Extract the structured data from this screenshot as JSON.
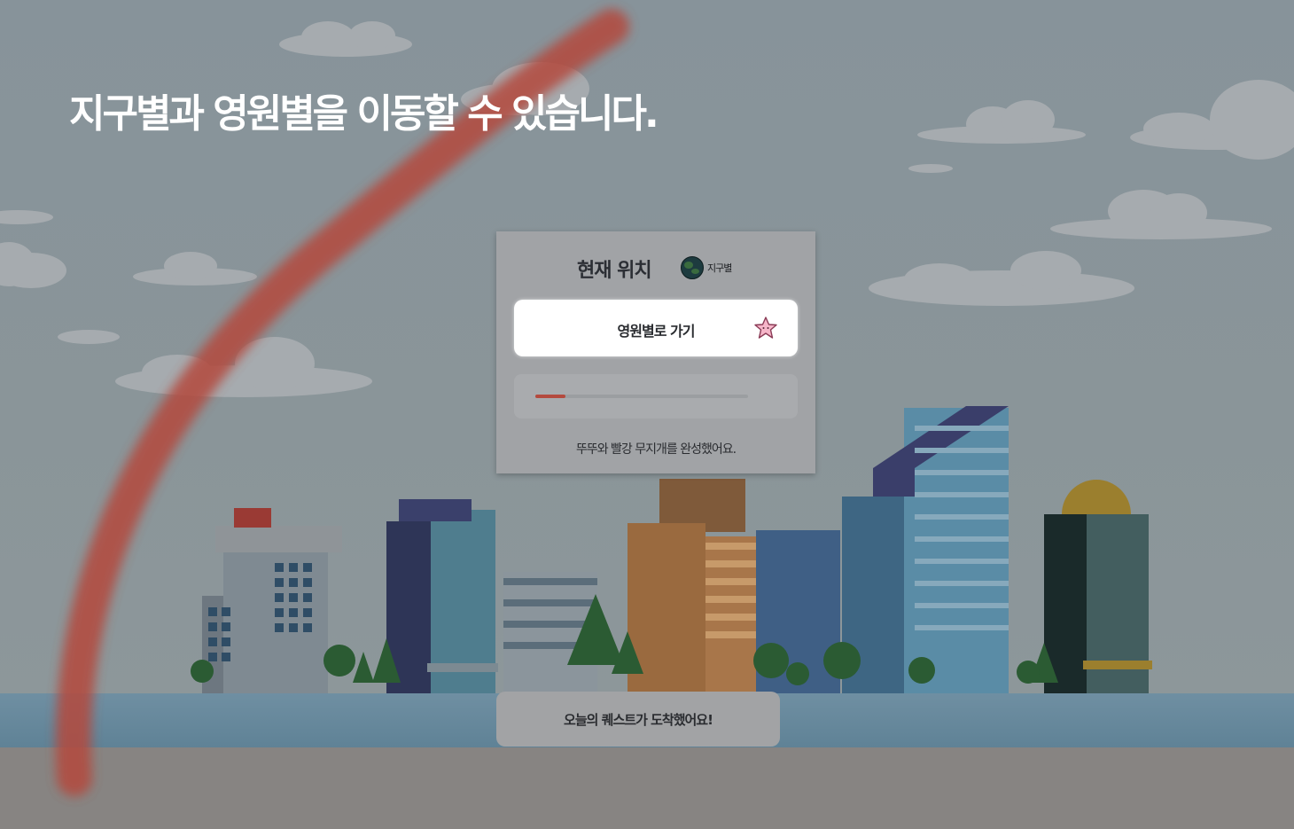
{
  "headline": "지구별과 영원별을 이동할 수 있습니다.",
  "location_panel": {
    "title": "현재 위치",
    "current_planet": "지구별",
    "go_button_label": "영원별로 가기",
    "progress": 0.14,
    "status_message": "뚜뚜와 빨강 무지개를 완성했어요."
  },
  "quest_banner": {
    "text": "오늘의 퀘스트가 도착했어요!"
  },
  "icons": {
    "earth": "earth-icon",
    "star": "star-icon"
  },
  "colors": {
    "rainbow_red": "#b44a3e",
    "button_bg": "#ffffff",
    "panel_bg": "#a1a3a6"
  }
}
